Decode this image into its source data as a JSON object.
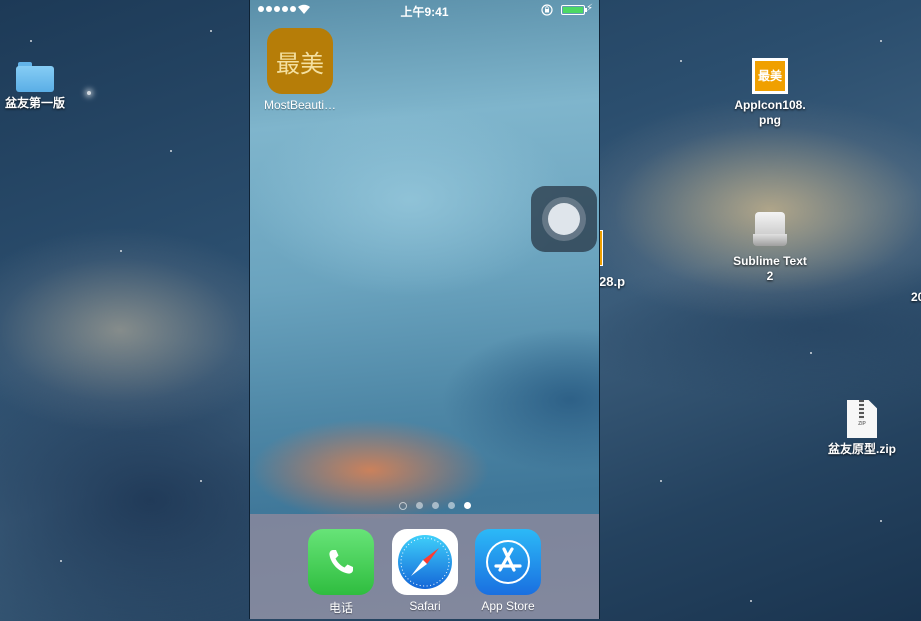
{
  "desktop": {
    "icons": [
      {
        "label": "盆友第一版"
      },
      {
        "label": "AppIcon108.png",
        "line1": "AppIcon108.",
        "line2": "png",
        "thumb_text": "最美"
      },
      {
        "label": "Sublime Text 2",
        "line1": "Sublime Text",
        "line2": "2"
      },
      {
        "label": "盆友原型.zip",
        "zip_text": "ZIP"
      }
    ],
    "partial_label": "28.p",
    "edge_text": "20"
  },
  "phone": {
    "status_bar": {
      "time": "上午9:41",
      "battery_color": "#4cd964"
    },
    "home_apps": [
      {
        "label": "MostBeauti…",
        "tile_text": "最美",
        "color": "#b67d08"
      }
    ],
    "page_dots": {
      "count": 4,
      "active_index": 3
    },
    "dock": [
      {
        "label": "电话",
        "icon": "phone-icon"
      },
      {
        "label": "Safari",
        "icon": "compass-icon"
      },
      {
        "label": "App Store",
        "icon": "appstore-icon"
      }
    ]
  }
}
